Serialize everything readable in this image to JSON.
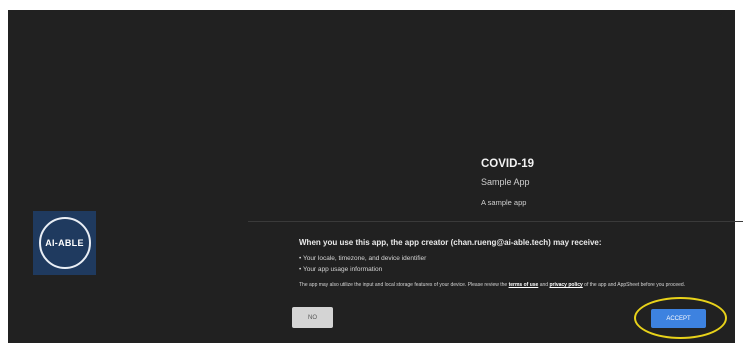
{
  "app": {
    "title": "COVID-19",
    "subtitle": "Sample App",
    "description": "A sample app"
  },
  "brand": {
    "logo_text": "AI-ABLE"
  },
  "consent": {
    "heading": "When you use this app, the app creator (chan.rueng@ai-able.tech) may receive:",
    "items": [
      "• Your locale, timezone, and device identifier",
      "• Your app usage information"
    ],
    "note_before_terms": "The app may also utilize the input and local storage features of your device. Please review the ",
    "terms_link": "terms of use",
    "note_between": " and ",
    "privacy_link": "privacy policy",
    "note_after": " of the app and AppSheet before you proceed."
  },
  "buttons": {
    "no_label": "NO",
    "accept_label": "ACCEPT"
  },
  "colors": {
    "background": "#212121",
    "accept": "#3d82e0",
    "no": "#d4d4d4",
    "highlight": "#e8d21a",
    "logo_bg": "#1f3a5f"
  }
}
